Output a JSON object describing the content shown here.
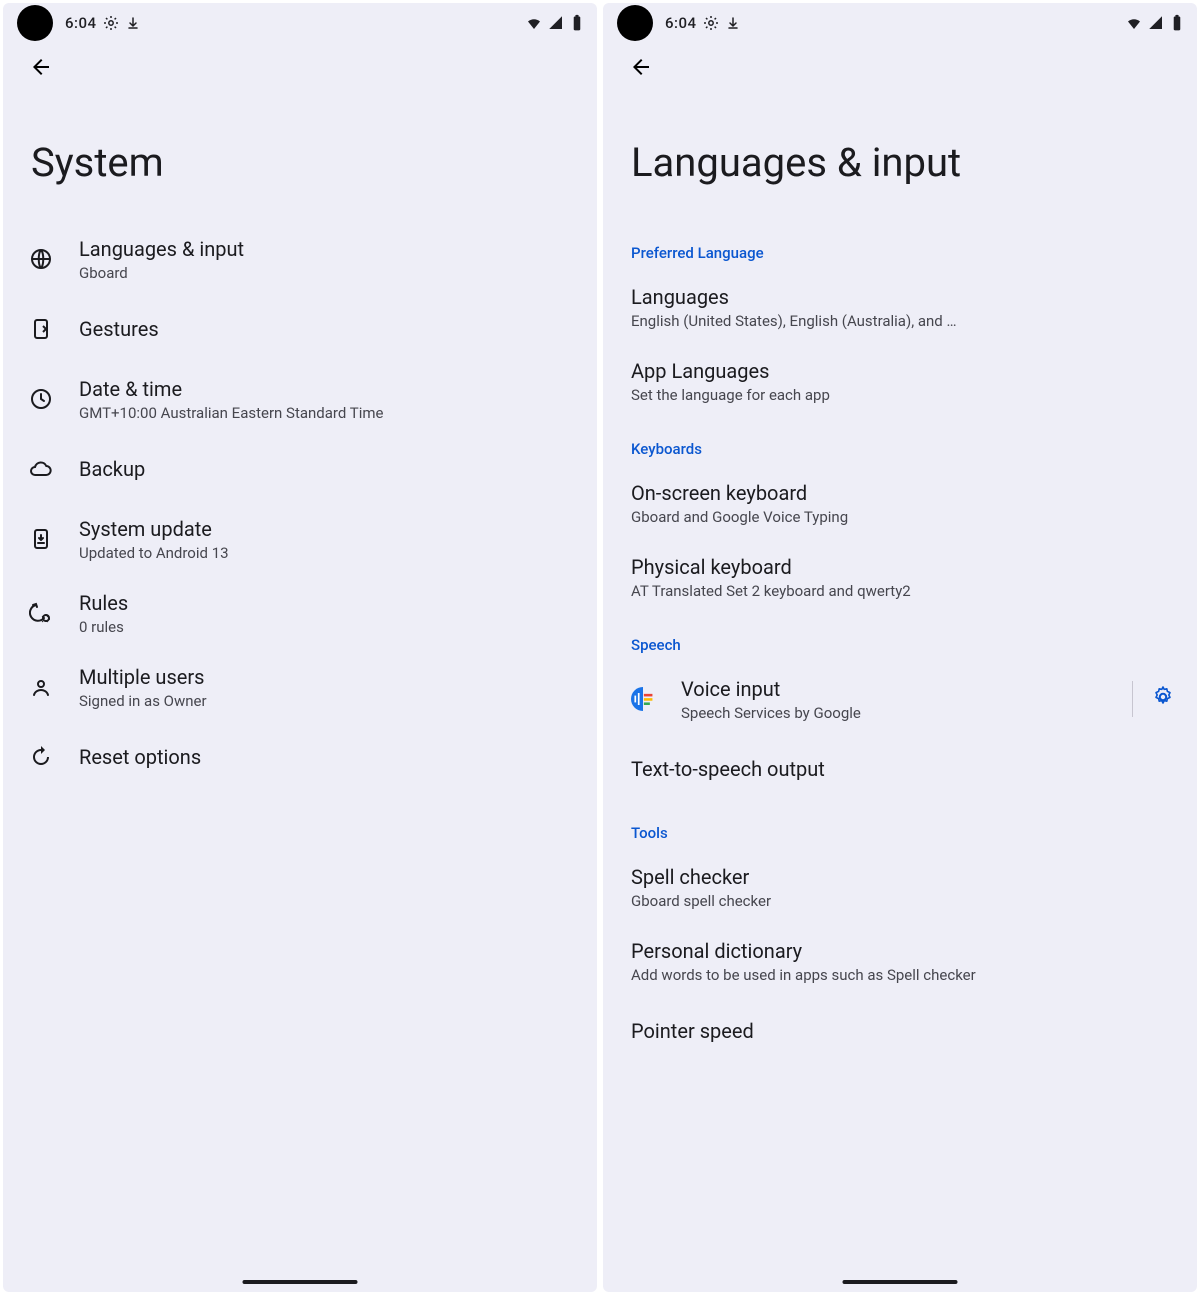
{
  "statusbar": {
    "time": "6:04"
  },
  "screen1": {
    "title": "System",
    "items": [
      {
        "icon": "globe-icon",
        "title": "Languages & input",
        "sub": "Gboard"
      },
      {
        "icon": "gesture-icon",
        "title": "Gestures",
        "sub": ""
      },
      {
        "icon": "clock-icon",
        "title": "Date & time",
        "sub": "GMT+10:00 Australian Eastern Standard Time"
      },
      {
        "icon": "cloud-icon",
        "title": "Backup",
        "sub": ""
      },
      {
        "icon": "update-icon",
        "title": "System update",
        "sub": "Updated to Android 13"
      },
      {
        "icon": "rules-icon",
        "title": "Rules",
        "sub": "0 rules"
      },
      {
        "icon": "person-icon",
        "title": "Multiple users",
        "sub": "Signed in as Owner"
      },
      {
        "icon": "reset-icon",
        "title": "Reset options",
        "sub": ""
      }
    ]
  },
  "screen2": {
    "title": "Languages & input",
    "sections": [
      {
        "header": "Preferred Language",
        "items": [
          {
            "title": "Languages",
            "sub": "English (United States), English (Australia), and …"
          },
          {
            "title": "App Languages",
            "sub": "Set the language for each app"
          }
        ]
      },
      {
        "header": "Keyboards",
        "items": [
          {
            "title": "On-screen keyboard",
            "sub": "Gboard and Google Voice Typing"
          },
          {
            "title": "Physical keyboard",
            "sub": "AT Translated Set 2 keyboard and qwerty2"
          }
        ]
      },
      {
        "header": "Speech",
        "items": [
          {
            "title": "Voice input",
            "sub": "Speech Services by Google",
            "leading_icon": "voice-icon",
            "trailing_gear": true
          },
          {
            "title": "Text-to-speech output",
            "sub": ""
          }
        ]
      },
      {
        "header": "Tools",
        "items": [
          {
            "title": "Spell checker",
            "sub": "Gboard spell checker"
          },
          {
            "title": "Personal dictionary",
            "sub": "Add words to be used in apps such as Spell checker"
          },
          {
            "title": "Pointer speed",
            "sub": ""
          }
        ]
      }
    ]
  }
}
